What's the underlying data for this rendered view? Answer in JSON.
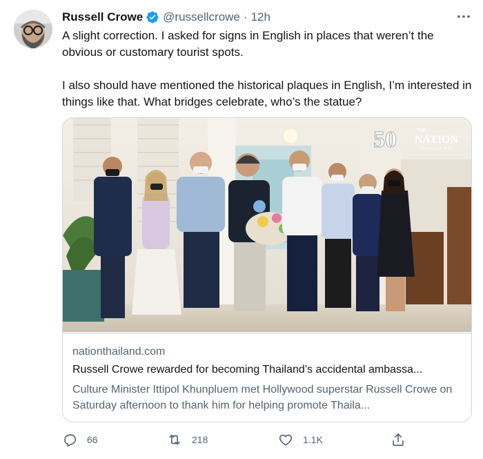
{
  "author": {
    "name": "Russell Crowe",
    "handle": "@russellcrowe",
    "separator": "·",
    "time": "12h"
  },
  "tweet": {
    "paragraphs": [
      "A slight correction. I asked for signs in English in places that weren’t the obvious or customary tourist spots.",
      "I also should have mentioned the historical plaques in English, I’m interested in things like that. What bridges celebrate, who’s the statue?"
    ]
  },
  "card": {
    "watermark_number": "50",
    "watermark_the": "THE",
    "watermark_brand": "NATION",
    "watermark_sub": "THAILAND",
    "domain": "nationthailand.com",
    "title": "Russell Crowe rewarded for becoming Thailand’s accidental ambassa...",
    "description": "Culture Minister Ittipol Khunpluem met Hollywood superstar Russell Crowe on Saturday afternoon to thank him for helping promote Thaila..."
  },
  "actions": {
    "replies": "66",
    "retweets": "218",
    "likes": "1.1K"
  },
  "colors": {
    "verified": "#1d9bf0",
    "muted": "#536471",
    "border": "#cfd9de"
  },
  "icons": [
    "more-icon",
    "verified-icon",
    "reply-icon",
    "retweet-icon",
    "like-icon",
    "share-icon"
  ]
}
